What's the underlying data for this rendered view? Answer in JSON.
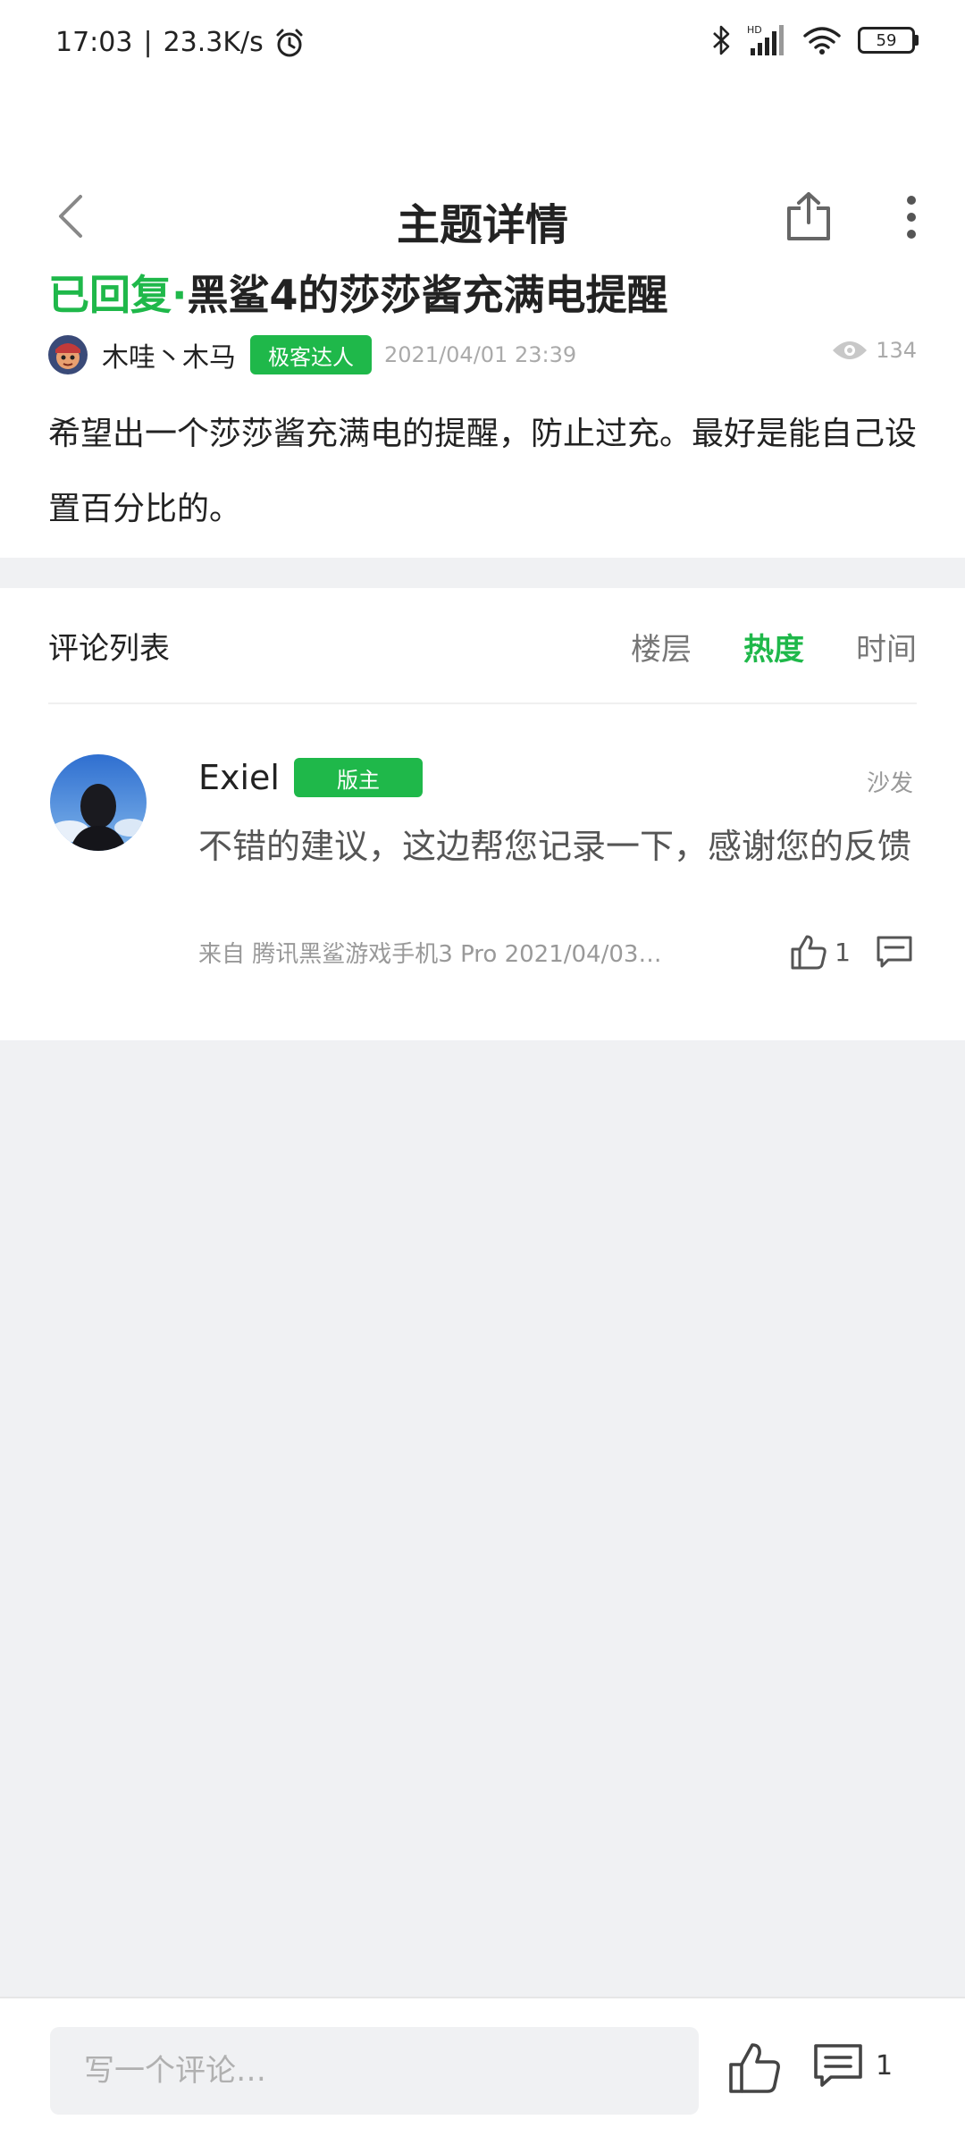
{
  "status_bar": {
    "time": "17:03",
    "separator": "|",
    "net_speed": "23.3K/s",
    "battery": "59",
    "icons": [
      "alarm-icon",
      "bluetooth-icon",
      "signal-icon",
      "wifi-icon",
      "battery-icon"
    ],
    "network_label": "HD"
  },
  "nav": {
    "title": "主题详情",
    "icons": [
      "back-icon",
      "share-icon",
      "more-icon"
    ]
  },
  "post": {
    "status_prefix": "已回复·",
    "title": "黑鲨4的莎莎酱充满电提醒",
    "author": "木哇丶木马",
    "author_badge": "极客达人",
    "time": "2021/04/01 23:39",
    "views": "134",
    "body": "希望出一个莎莎酱充满电的提醒，防止过充。最好是能自己设置百分比的。"
  },
  "comments": {
    "header": "评论列表",
    "sort_tabs": [
      "楼层",
      "热度",
      "时间"
    ],
    "active_sort": "热度",
    "items": [
      {
        "user": "Exiel",
        "badge": "版主",
        "floor": "沙发",
        "text": "不错的建议，这边帮您记录一下，感谢您的反馈",
        "source": "来自 腾讯黑鲨游戏手机3 Pro  2021/04/03…",
        "likes": "1"
      }
    ]
  },
  "bottom_bar": {
    "placeholder": "写一个评论…",
    "comment_count": "1"
  },
  "colors": {
    "accent": "#1fb84a",
    "background": "#f0f1f3",
    "surface": "#ffffff",
    "text_primary": "#222222",
    "text_secondary": "#999999"
  }
}
